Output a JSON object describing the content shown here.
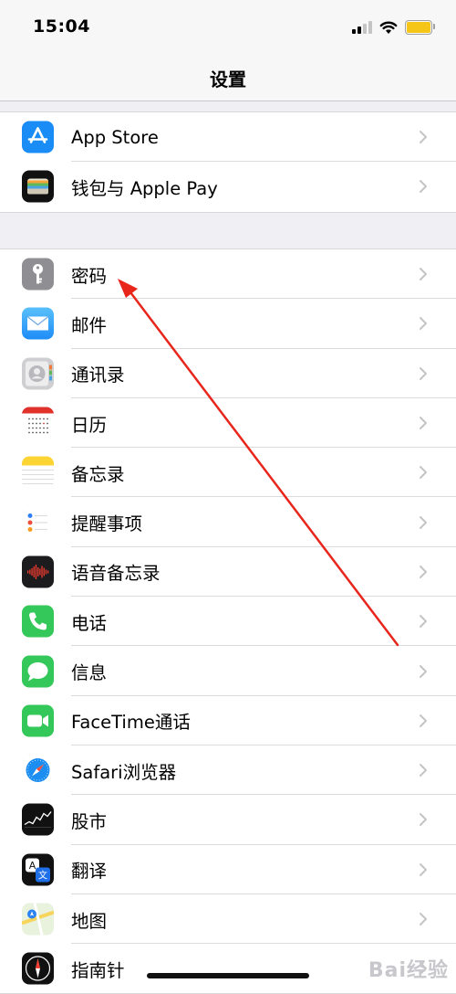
{
  "status_bar": {
    "time": "15:04",
    "battery_color": "#f5c518"
  },
  "nav": {
    "title": "设置"
  },
  "groups": [
    {
      "items": [
        {
          "label": "App Store",
          "icon": "app-store-icon",
          "color": "#1a8cf6"
        },
        {
          "label": "钱包与 Apple Pay",
          "icon": "wallet-icon",
          "color": "#111111"
        }
      ]
    },
    {
      "items": [
        {
          "label": "密码",
          "icon": "key-icon",
          "color": "#8e8e93"
        },
        {
          "label": "邮件",
          "icon": "mail-icon",
          "color": "#1e8cf7"
        },
        {
          "label": "通讯录",
          "icon": "contacts-icon",
          "color": "#cfcfd2"
        },
        {
          "label": "日历",
          "icon": "calendar-icon",
          "color": "#ffffff"
        },
        {
          "label": "备忘录",
          "icon": "notes-icon",
          "color": "#ffffff"
        },
        {
          "label": "提醒事项",
          "icon": "reminders-icon",
          "color": "#ffffff"
        },
        {
          "label": "语音备忘录",
          "icon": "voice-memos-icon",
          "color": "#1c1c1e"
        },
        {
          "label": "电话",
          "icon": "phone-icon",
          "color": "#34c759"
        },
        {
          "label": "信息",
          "icon": "messages-icon",
          "color": "#34c759"
        },
        {
          "label": "FaceTime通话",
          "icon": "facetime-icon",
          "color": "#34c759"
        },
        {
          "label": "Safari浏览器",
          "icon": "safari-icon",
          "color": "#ffffff"
        },
        {
          "label": "股市",
          "icon": "stocks-icon",
          "color": "#111111"
        },
        {
          "label": "翻译",
          "icon": "translate-icon",
          "color": "#111111"
        },
        {
          "label": "地图",
          "icon": "maps-icon",
          "color": "#e8f2dd"
        },
        {
          "label": "指南针",
          "icon": "compass-icon",
          "color": "#111111"
        }
      ]
    }
  ],
  "annotation": {
    "color": "#e8261c"
  },
  "watermark": "Bai经验"
}
